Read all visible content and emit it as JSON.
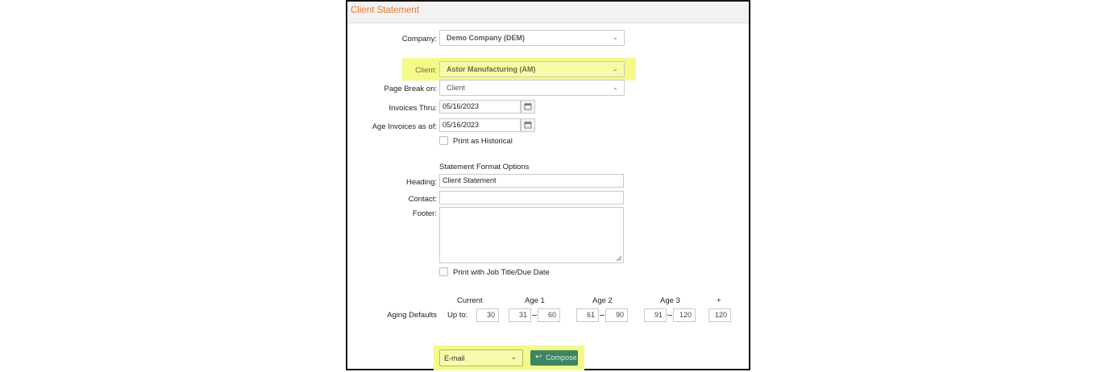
{
  "panel": {
    "title": "Client Statement"
  },
  "company": {
    "label": "Company:",
    "value": "Demo Company (DEM)"
  },
  "client": {
    "label": "Client:",
    "value": "Astor Manufacturing (AM)"
  },
  "page_break": {
    "label": "Page Break on:",
    "value": "Client"
  },
  "invoices_thru": {
    "label": "Invoices Thru:",
    "value": "05/16/2023"
  },
  "age_invoices": {
    "label": "Age Invoices as of:",
    "value": "05/16/2023"
  },
  "print_historical": {
    "label": "Print as Historical",
    "checked": false
  },
  "format": {
    "section_title": "Statement Format Options",
    "heading_label": "Heading:",
    "heading_value": "Client Statement",
    "contact_label": "Contact:",
    "contact_value": "",
    "footer_label": "Footer:",
    "footer_value": ""
  },
  "print_job_title": {
    "label": "Print with Job Title/Due Date",
    "checked": false
  },
  "aging": {
    "label": "Aging Defaults",
    "upto_label": "Up to:",
    "headers": [
      "Current",
      "Age 1",
      "Age 2",
      "Age 3",
      "+"
    ],
    "current": "30",
    "age1_from": "31",
    "age1_to": "60",
    "age2_from": "61",
    "age2_to": "90",
    "age3_from": "91",
    "age3_to": "120",
    "plus": "120"
  },
  "output": {
    "value": "E-mail",
    "compose_label": "Compose"
  },
  "colors": {
    "accent": "#e87a2c",
    "highlight": "#f4f989",
    "compose": "#3b8561"
  }
}
